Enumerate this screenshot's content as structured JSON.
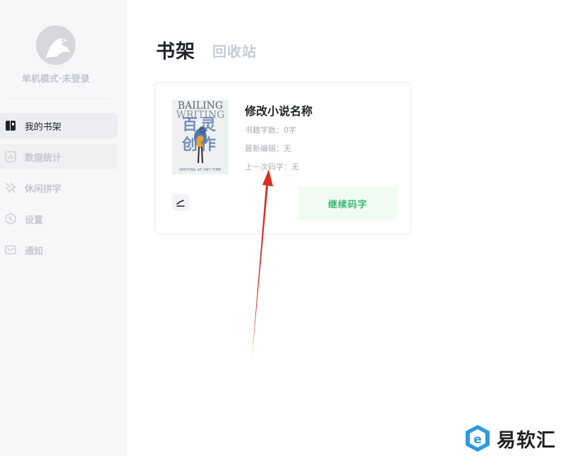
{
  "user": {
    "status": "单机模式·未登录"
  },
  "sidebar": {
    "items": [
      {
        "label": "我的书架",
        "icon": "book-icon"
      },
      {
        "label": "数据统计",
        "icon": "bar-chart-icon"
      },
      {
        "label": "休闲拼字",
        "icon": "puzzle-icon"
      },
      {
        "label": "设置",
        "icon": "settings-icon"
      },
      {
        "label": "通知",
        "icon": "mail-icon"
      }
    ]
  },
  "header": {
    "title": "书架",
    "recycle_tab": "回收站"
  },
  "book": {
    "name": "修改小说名称",
    "word_count": "书籍字数：0字",
    "last_edit": "最新编辑：无",
    "last_typing": "上一次码字：无",
    "continue_label": "继续码字",
    "cover": {
      "line1": "BAILING",
      "line2": "WRITING",
      "chars": "百灵 创作",
      "bottom": "WRITING AT ANY TIME"
    }
  },
  "watermark": {
    "text": "易软汇"
  },
  "colors": {
    "accent": "#3fb86e",
    "arrow": "#d62f24"
  }
}
